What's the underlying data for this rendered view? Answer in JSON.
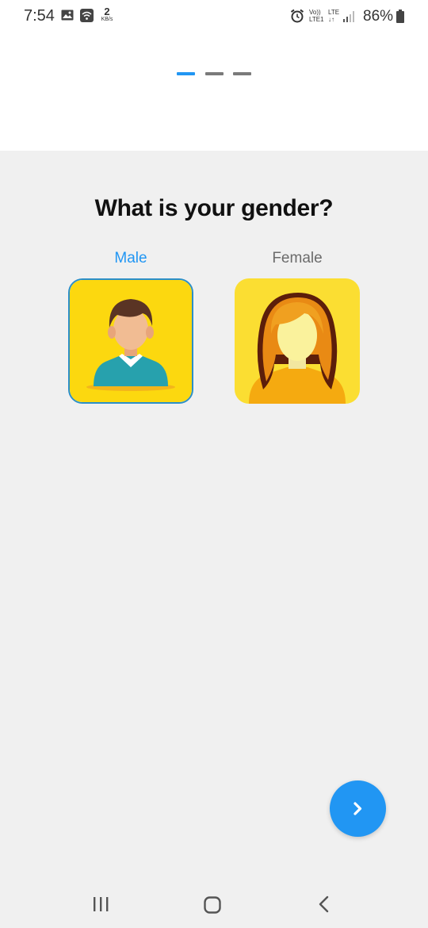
{
  "status_bar": {
    "time": "7:54",
    "data_rate_value": "2",
    "data_rate_unit": "KB/s",
    "volte_top": "Vo))",
    "volte_bottom": "LTE1",
    "lte_top": "LTE",
    "lte_bottom": "↓↑",
    "battery_percent": "86%",
    "icons": [
      "gallery-icon",
      "wifi-icon",
      "alarm-icon",
      "signal-icon",
      "battery-icon"
    ]
  },
  "onboarding": {
    "step_current": 1,
    "step_total": 3,
    "active_color": "#2196f3",
    "inactive_color": "#7a7a7a"
  },
  "main": {
    "question": "What is your gender?",
    "options": [
      {
        "label": "Male",
        "selected": true,
        "label_color": "#2196f3",
        "icon": "male-avatar-icon"
      },
      {
        "label": "Female",
        "selected": false,
        "label_color": "#6b6b6b",
        "icon": "female-avatar-icon"
      }
    ],
    "next_icon": "chevron-right-icon"
  },
  "nav_bar": {
    "buttons": [
      "recent-apps-icon",
      "home-icon",
      "back-icon"
    ]
  }
}
